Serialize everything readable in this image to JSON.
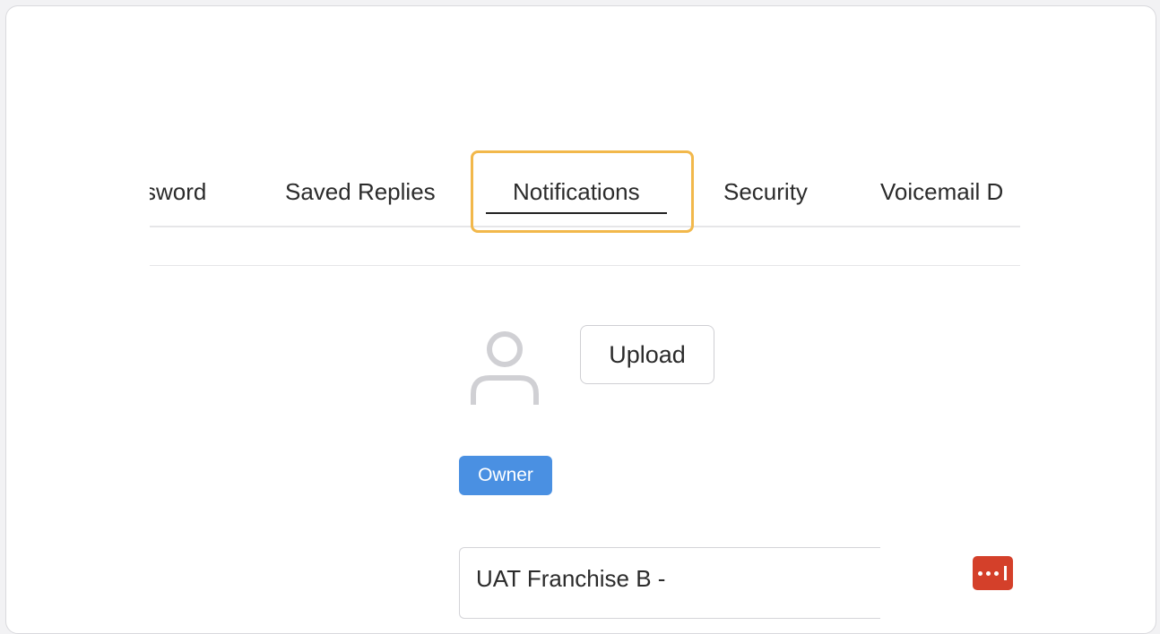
{
  "tabs": [
    {
      "label": "Password",
      "visible_label": "sword",
      "active": false
    },
    {
      "label": "Saved Replies",
      "active": false
    },
    {
      "label": "Notifications",
      "active": true
    },
    {
      "label": "Security",
      "active": false
    },
    {
      "label": "Voicemail D",
      "active": false
    }
  ],
  "profile": {
    "upload_label": "Upload",
    "role_badge": "Owner",
    "name_value": "UAT Franchise B -"
  },
  "icons": {
    "avatar": "user-avatar-placeholder-icon",
    "password_manager": "password-manager-icon"
  },
  "colors": {
    "highlight": "#f2b84b",
    "badge": "#4a90e2",
    "password_manager": "#d4402a"
  }
}
